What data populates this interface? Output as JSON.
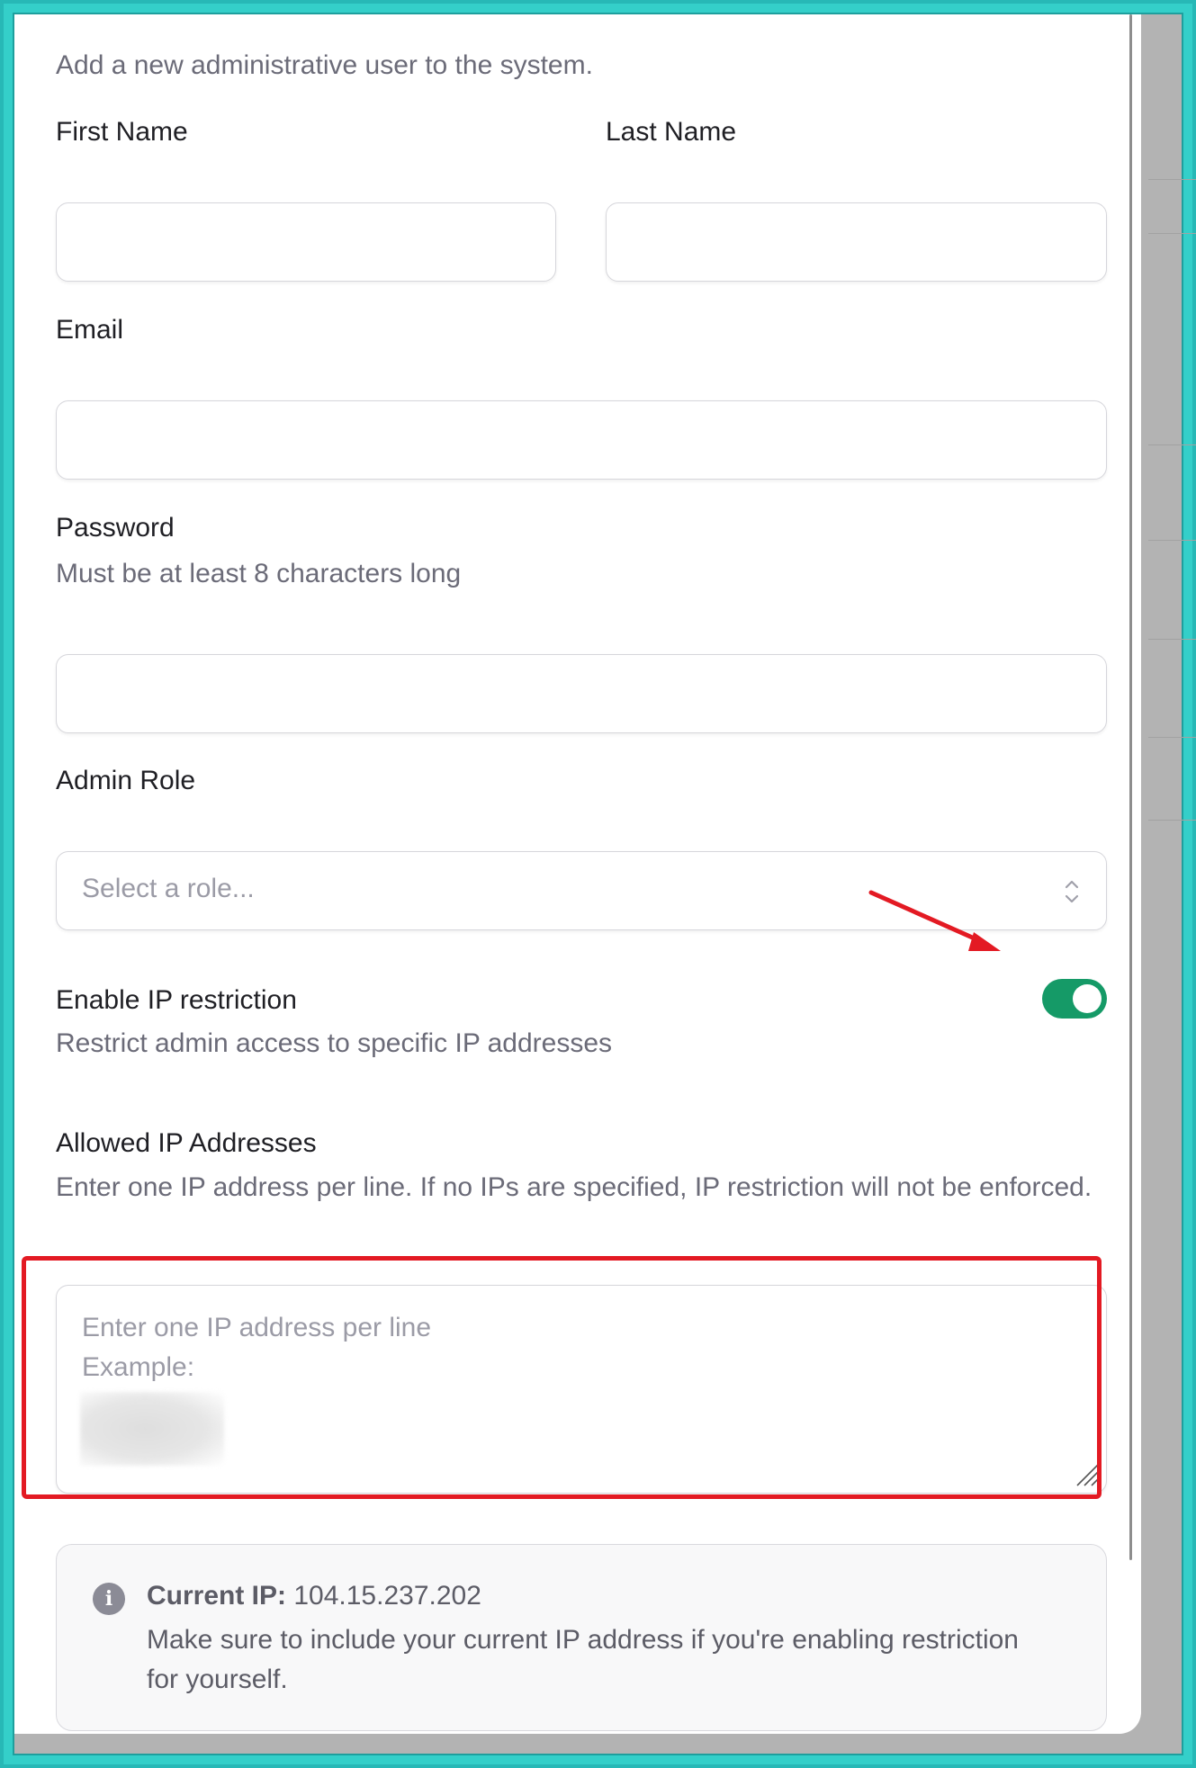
{
  "form": {
    "subtitle": "Add a new administrative user to the system.",
    "first_name_label": "First Name",
    "first_name_value": "",
    "last_name_label": "Last Name",
    "last_name_value": "",
    "email_label": "Email",
    "email_value": "",
    "password_label": "Password",
    "password_help": "Must be at least 8 characters long",
    "password_value": "",
    "role_label": "Admin Role",
    "role_placeholder": "Select a role...",
    "ip_restriction_label": "Enable IP restriction",
    "ip_restriction_help": "Restrict admin access to specific IP addresses",
    "ip_restriction_enabled": true,
    "allowed_ips_label": "Allowed IP Addresses",
    "allowed_ips_help": "Enter one IP address per line. If no IPs are specified, IP restriction will not be enforced.",
    "allowed_ips_placeholder_line1": "Enter one IP address per line",
    "allowed_ips_placeholder_line2": "Example:",
    "info_title": "Current IP:",
    "info_ip": "104.15.237.202",
    "info_body": "Make sure to include your current IP address if you're enabling restriction for yourself."
  },
  "colors": {
    "toggle_on": "#159a67",
    "annotation_red": "#e31a23",
    "frame_teal": "#34cfc9"
  },
  "icons": {
    "select": "chevron-up-down-icon",
    "info": "info-circle-icon",
    "resize": "resize-handle-icon"
  }
}
